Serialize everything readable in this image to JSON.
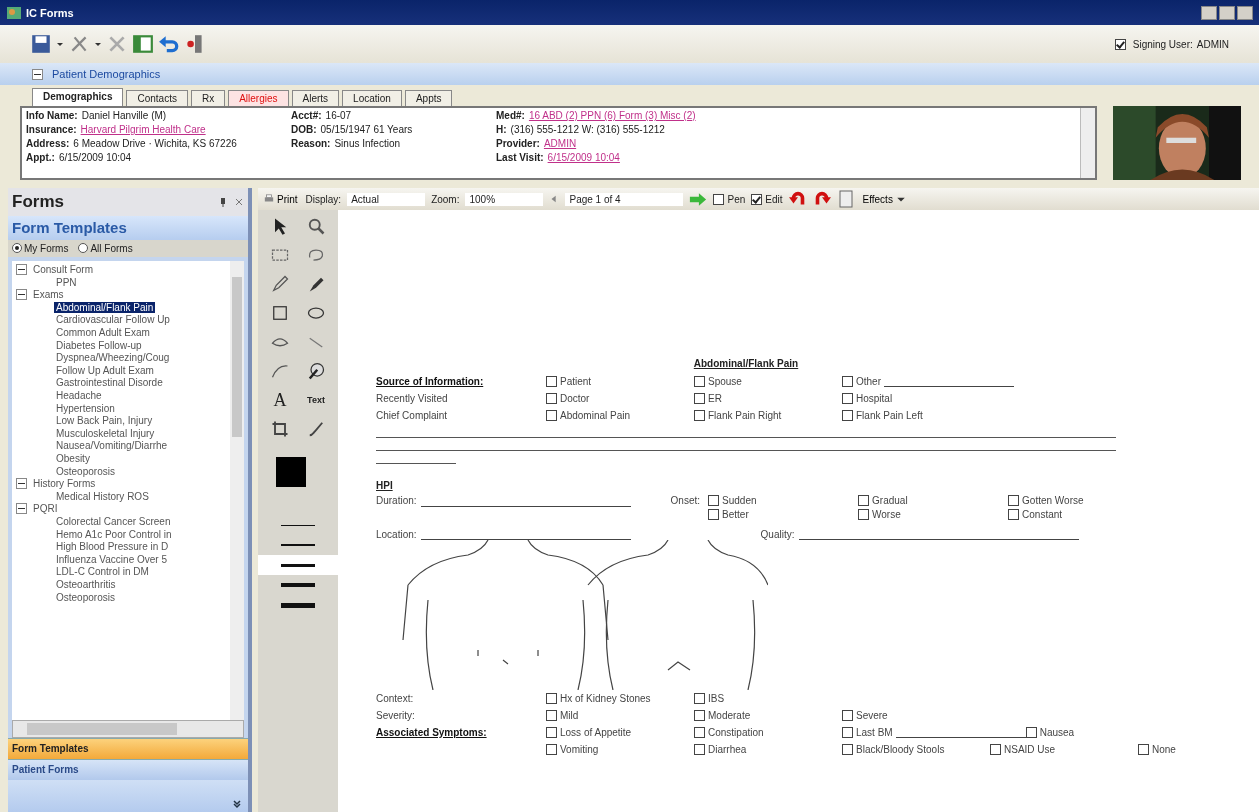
{
  "window": {
    "title": "IC Forms"
  },
  "signing_user": {
    "label": "Signing User:",
    "value": "ADMIN",
    "checked": true
  },
  "demographics": {
    "title": "Patient Demographics",
    "expanded": true
  },
  "tabs": [
    {
      "label": "Demographics",
      "selected": true,
      "alert": false
    },
    {
      "label": "Contacts",
      "selected": false,
      "alert": false
    },
    {
      "label": "Rx",
      "selected": false,
      "alert": false
    },
    {
      "label": "Allergies",
      "selected": false,
      "alert": true
    },
    {
      "label": "Alerts",
      "selected": false,
      "alert": false
    },
    {
      "label": "Location",
      "selected": false,
      "alert": false
    },
    {
      "label": "Appts",
      "selected": false,
      "alert": false
    }
  ],
  "info": [
    [
      {
        "label": "Info Name:",
        "value": "Daniel Hanville (M)",
        "link": false
      },
      {
        "label": "Insurance:",
        "value": "Harvard Pilgrim Health Care",
        "link": true
      },
      {
        "label": "Address:",
        "value": "6 Meadow Drive · Wichita, KS 67226",
        "link": false
      },
      {
        "label": "Appt.:",
        "value": "6/15/2009 10:04",
        "link": false
      }
    ],
    [
      {
        "label": "Acct#:",
        "value": "16-07",
        "link": false
      },
      {
        "label": "DOB:",
        "value": "05/15/1947 61 Years",
        "link": false
      },
      {
        "label": "Reason:",
        "value": "Sinus Infection",
        "link": false
      }
    ],
    [
      {
        "label": "Med#:",
        "value": "16  ABD (2) PPN (6) Form (3) Misc (2)",
        "link": true
      },
      {
        "label": "H:",
        "value": "(316) 555-1212  W: (316) 555-1212",
        "link": false
      },
      {
        "label": "Provider:",
        "value": "ADMIN",
        "link": true
      },
      {
        "label": "Last Visit:",
        "value": "6/15/2009 10:04",
        "link": true
      }
    ]
  ],
  "forms": {
    "title": "Forms",
    "section": "Form Templates",
    "filters": [
      {
        "label": "My Forms",
        "selected": true
      },
      {
        "label": "All Forms",
        "selected": false
      }
    ],
    "tree": [
      {
        "label": "Consult Form",
        "expanded": true,
        "selected": false,
        "children": [
          {
            "label": "PPN",
            "selected": false
          }
        ]
      },
      {
        "label": "Exams",
        "expanded": true,
        "selected": false,
        "children": [
          {
            "label": "Abdominal/Flank Pain",
            "selected": true
          },
          {
            "label": "Cardiovascular Follow Up",
            "selected": false
          },
          {
            "label": "Common Adult Exam",
            "selected": false
          },
          {
            "label": "Diabetes Follow-up",
            "selected": false
          },
          {
            "label": "Dyspnea/Wheezing/Coug",
            "selected": false
          },
          {
            "label": "Follow Up Adult Exam",
            "selected": false
          },
          {
            "label": "Gastrointestinal Disorde",
            "selected": false
          },
          {
            "label": "Headache",
            "selected": false
          },
          {
            "label": "Hypertension",
            "selected": false
          },
          {
            "label": "Low Back Pain, Injury",
            "selected": false
          },
          {
            "label": "Musculoskeletal Injury",
            "selected": false
          },
          {
            "label": "Nausea/Vomiting/Diarrhe",
            "selected": false
          },
          {
            "label": "Obesity",
            "selected": false
          },
          {
            "label": "Osteoporosis",
            "selected": false
          }
        ]
      },
      {
        "label": "History Forms",
        "expanded": true,
        "selected": false,
        "children": [
          {
            "label": "Medical History ROS",
            "selected": false
          }
        ]
      },
      {
        "label": "PQRI",
        "expanded": true,
        "selected": false,
        "children": [
          {
            "label": "Colorectal Cancer Screen",
            "selected": false
          },
          {
            "label": "Hemo A1c Poor Control in",
            "selected": false
          },
          {
            "label": "High Blood Pressure in D",
            "selected": false
          },
          {
            "label": "Influenza Vaccine Over 5",
            "selected": false
          },
          {
            "label": "LDL-C Control in DM",
            "selected": false
          },
          {
            "label": "Osteoarthritis",
            "selected": false
          },
          {
            "label": "Osteoporosis",
            "selected": false
          }
        ]
      }
    ],
    "panels": [
      {
        "label": "Form Templates",
        "selected": true
      },
      {
        "label": "Patient Forms",
        "selected": false
      }
    ]
  },
  "form_toolbar": {
    "print": "Print",
    "display_label": "Display:",
    "display": "Actual",
    "zoom_label": "Zoom:",
    "zoom": "100%",
    "page": "Page 1 of 4",
    "checks": [
      {
        "label": "Pen",
        "checked": false
      },
      {
        "label": "Edit",
        "checked": true
      }
    ],
    "effects": "Effects"
  },
  "tools": {
    "letter": "A",
    "text": "Text",
    "line_widths": [
      {
        "selected": false
      },
      {
        "selected": false
      },
      {
        "selected": true
      },
      {
        "selected": false
      },
      {
        "selected": false
      }
    ]
  },
  "document": {
    "title": "Abdominal/Flank Pain",
    "blocks": [
      {
        "kind": "options",
        "label": "Source of Information:",
        "underlined": true,
        "options": [
          {
            "label": "Patient",
            "checked": false,
            "blank": false
          },
          {
            "label": "Spouse",
            "checked": false,
            "blank": false
          },
          {
            "label": "Other",
            "checked": false,
            "blank": true
          }
        ]
      },
      {
        "kind": "options",
        "label": "Recently Visited",
        "underlined": false,
        "options": [
          {
            "label": "Doctor",
            "checked": false,
            "blank": false
          },
          {
            "label": "ER",
            "checked": false,
            "blank": false
          },
          {
            "label": "Hospital",
            "checked": false,
            "blank": false
          }
        ]
      },
      {
        "kind": "options",
        "label": "Chief Complaint",
        "underlined": false,
        "options": [
          {
            "label": "Abdominal Pain",
            "checked": false,
            "blank": false
          },
          {
            "label": "Flank Pain Right",
            "checked": false,
            "blank": false
          },
          {
            "label": "Flank Pain Left",
            "checked": false,
            "blank": false
          }
        ]
      },
      {
        "kind": "rules"
      },
      {
        "kind": "heading",
        "label": "HPI"
      },
      {
        "kind": "hpi",
        "left": "Duration:",
        "right": "Onset:",
        "options": [
          {
            "label": "Sudden",
            "checked": false
          },
          {
            "label": "Gradual",
            "checked": false
          },
          {
            "label": "Gotten Worse",
            "checked": false
          },
          {
            "label": "Better",
            "checked": false
          },
          {
            "label": "Worse",
            "checked": false
          },
          {
            "label": "Constant",
            "checked": false
          }
        ]
      },
      {
        "kind": "fields",
        "left": "Location:",
        "right": "Quality:"
      },
      {
        "kind": "body_diagram"
      },
      {
        "kind": "options",
        "label": "Context:",
        "underlined": false,
        "options": [
          {
            "label": "Hx of Kidney Stones",
            "checked": false,
            "blank": false
          },
          {
            "label": "IBS",
            "checked": false,
            "blank": false
          }
        ]
      },
      {
        "kind": "options",
        "label": "Severity:",
        "underlined": false,
        "options": [
          {
            "label": "Mild",
            "checked": false,
            "blank": false
          },
          {
            "label": "Moderate",
            "checked": false,
            "blank": false
          },
          {
            "label": "Severe",
            "checked": false,
            "blank": false
          }
        ]
      },
      {
        "kind": "options",
        "label": "Associated Symptoms:",
        "underlined": true,
        "options": [
          {
            "label": "Loss of Appetite",
            "checked": false,
            "blank": false
          },
          {
            "label": "Constipation",
            "checked": false,
            "blank": false
          },
          {
            "label": "Last BM",
            "checked": false,
            "blank": true
          },
          {
            "label": "Nausea",
            "checked": false,
            "blank": false
          }
        ]
      },
      {
        "kind": "options",
        "options": [
          {
            "label": "Vomiting",
            "checked": false,
            "blank": false
          },
          {
            "label": "Diarrhea",
            "checked": false,
            "blank": false
          },
          {
            "label": "Black/Bloody Stools",
            "checked": false,
            "blank": false
          },
          {
            "label": "NSAID Use",
            "checked": false,
            "blank": false
          },
          {
            "label": "None",
            "checked": false,
            "blank": false
          }
        ]
      }
    ]
  }
}
